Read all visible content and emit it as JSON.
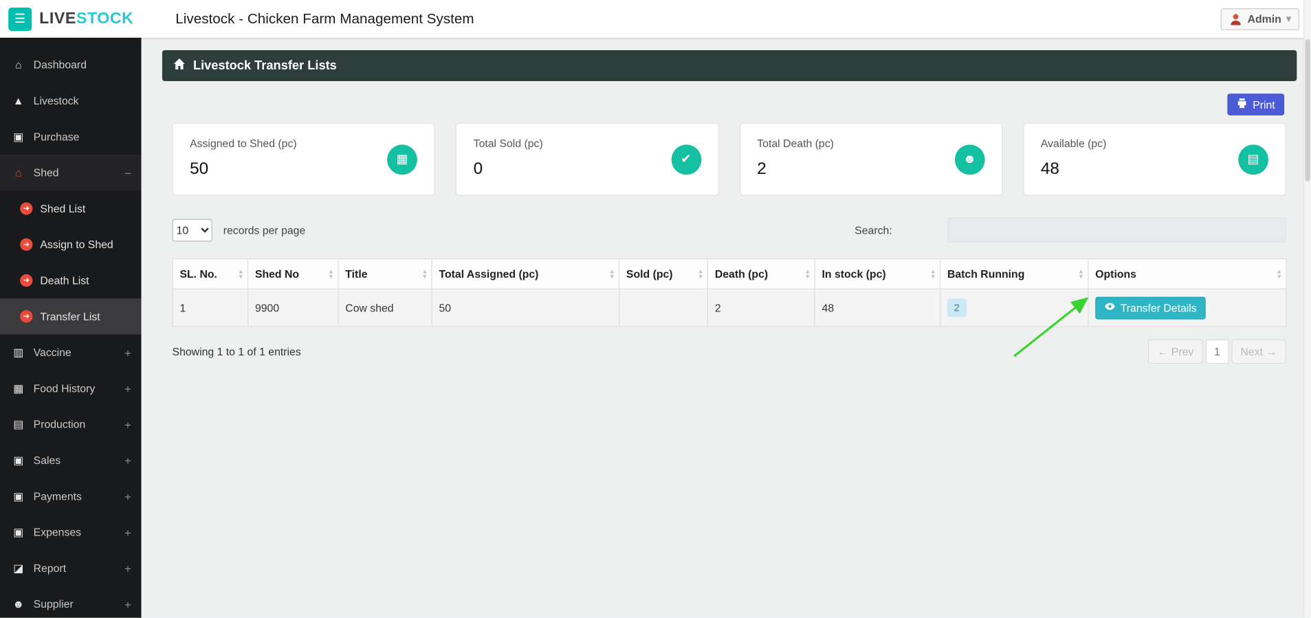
{
  "colors": {
    "accent_teal": "#00bfae",
    "logo_cyan": "#29c8d6",
    "panel_header_dark": "#2d3e3d",
    "print_button_blue": "#4c5cd6",
    "stat_icon_teal": "#14bfa2",
    "transfer_button_teal": "#2fb6c5",
    "sidebar_icon_red": "#e74c3c",
    "badge_blue_bg": "#cde9f6",
    "annotation_arrow_green": "#3bd331"
  },
  "topbar": {
    "logo_live": "LIVE",
    "logo_stock": "STOCK",
    "title": "Livestock - Chicken Farm Management System",
    "user_label": "Admin"
  },
  "sidebar": {
    "items": [
      {
        "label": "Dashboard"
      },
      {
        "label": "Livestock"
      },
      {
        "label": "Purchase"
      },
      {
        "label": "Shed",
        "toggle": "−"
      },
      {
        "label": "Vaccine",
        "toggle": "+"
      },
      {
        "label": "Food History",
        "toggle": "+"
      },
      {
        "label": "Production",
        "toggle": "+"
      },
      {
        "label": "Sales",
        "toggle": "+"
      },
      {
        "label": "Payments",
        "toggle": "+"
      },
      {
        "label": "Expenses",
        "toggle": "+"
      },
      {
        "label": "Report",
        "toggle": "+"
      },
      {
        "label": "Supplier",
        "toggle": "+"
      }
    ],
    "shed_sub": [
      {
        "label": "Shed List"
      },
      {
        "label": "Assign to Shed"
      },
      {
        "label": "Death List"
      },
      {
        "label": "Transfer List"
      }
    ]
  },
  "panel": {
    "title": "Livestock Transfer Lists"
  },
  "toolbar": {
    "print_label": "Print"
  },
  "stats": [
    {
      "label": "Assigned to Shed (pc)",
      "value": "50"
    },
    {
      "label": "Total Sold (pc)",
      "value": "0"
    },
    {
      "label": "Total Death (pc)",
      "value": "2"
    },
    {
      "label": "Available (pc)",
      "value": "48"
    }
  ],
  "controls": {
    "page_size": "10",
    "records_text": "records per page",
    "search_label": "Search:"
  },
  "table": {
    "headers": [
      "SL. No.",
      "Shed No",
      "Title",
      "Total Assigned (pc)",
      "Sold (pc)",
      "Death (pc)",
      "In stock (pc)",
      "Batch Running",
      "Options"
    ],
    "rows": [
      {
        "sl_no": "1",
        "shed_no": "9900",
        "title": "Cow shed",
        "total_assigned": "50",
        "sold": "",
        "death": "2",
        "in_stock": "48",
        "batch_running": "2",
        "action_label": "Transfer Details"
      }
    ]
  },
  "footer": {
    "showing": "Showing 1 to 1 of 1 entries",
    "prev_label": "← Prev",
    "page_label": "1",
    "next_label": "Next →"
  }
}
